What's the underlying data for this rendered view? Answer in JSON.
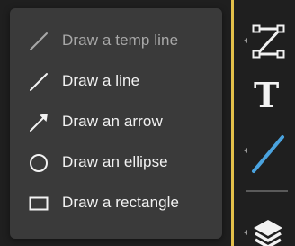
{
  "menu": {
    "items": [
      {
        "label": "Draw a temp line",
        "icon": "temp-line-icon",
        "dim": true
      },
      {
        "label": "Draw a line",
        "icon": "line-icon",
        "dim": false
      },
      {
        "label": "Draw an arrow",
        "icon": "arrow-icon",
        "dim": false
      },
      {
        "label": "Draw an ellipse",
        "icon": "ellipse-icon",
        "dim": false
      },
      {
        "label": "Draw a rectangle",
        "icon": "rectangle-icon",
        "dim": false
      }
    ]
  },
  "toolbar": {
    "text_tool_glyph": "T",
    "tools": [
      "path-icon",
      "text-icon",
      "line-tool-icon",
      "layers-icon"
    ]
  },
  "colors": {
    "menu_bg": "#3a3a3a",
    "accent_divider": "#e3c04a",
    "active_line": "#4aa3df"
  }
}
